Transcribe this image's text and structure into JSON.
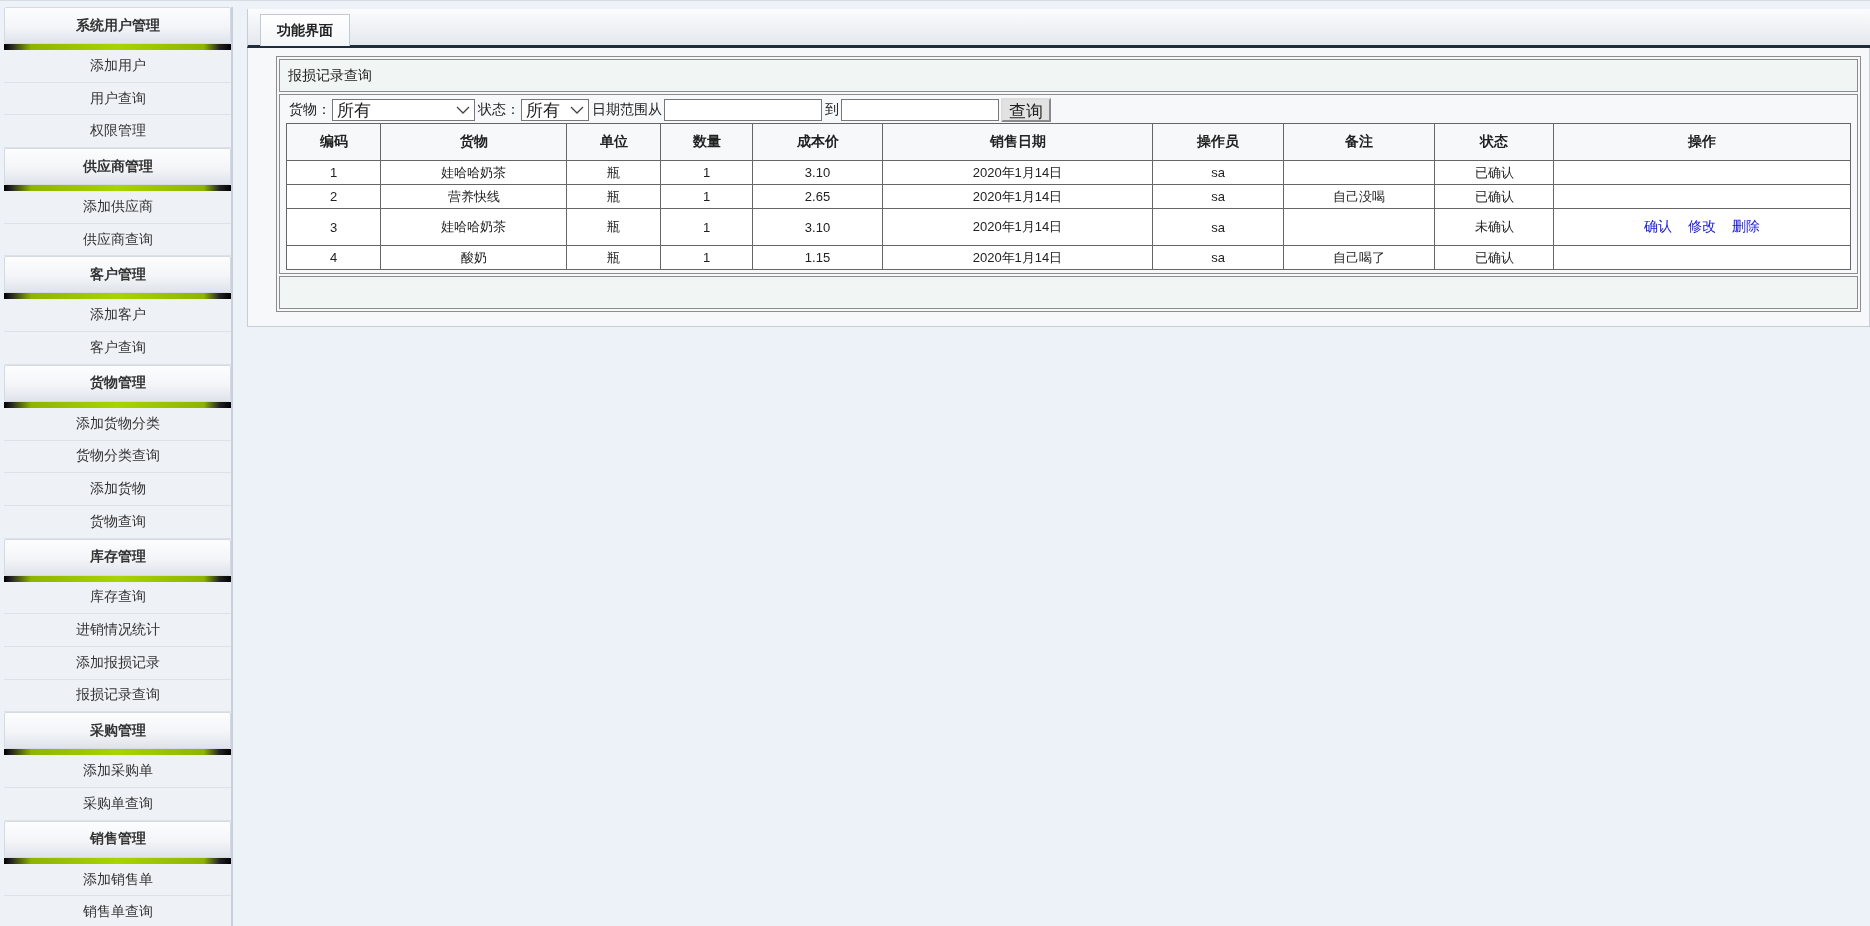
{
  "sidebar": {
    "sections": [
      {
        "title": "系统用户管理",
        "items": [
          {
            "label": "添加用户",
            "selected": false
          },
          {
            "label": "用户查询",
            "selected": false
          },
          {
            "label": "权限管理",
            "selected": false
          }
        ]
      },
      {
        "title": "供应商管理",
        "items": [
          {
            "label": "添加供应商",
            "selected": false
          },
          {
            "label": "供应商查询",
            "selected": false
          }
        ]
      },
      {
        "title": "客户管理",
        "items": [
          {
            "label": "添加客户",
            "selected": false
          },
          {
            "label": "客户查询",
            "selected": false
          }
        ]
      },
      {
        "title": "货物管理",
        "items": [
          {
            "label": "添加货物分类",
            "selected": false
          },
          {
            "label": "货物分类查询",
            "selected": false
          },
          {
            "label": "添加货物",
            "selected": false
          },
          {
            "label": "货物查询",
            "selected": false
          }
        ]
      },
      {
        "title": "库存管理",
        "items": [
          {
            "label": "库存查询",
            "selected": false
          },
          {
            "label": "进销情况统计",
            "selected": false
          },
          {
            "label": "添加报损记录",
            "selected": false
          },
          {
            "label": "报损记录查询",
            "selected": false
          }
        ]
      },
      {
        "title": "采购管理",
        "items": [
          {
            "label": "添加采购单",
            "selected": false
          },
          {
            "label": "采购单查询",
            "selected": false
          }
        ]
      },
      {
        "title": "销售管理",
        "items": [
          {
            "label": "添加销售单",
            "selected": false
          },
          {
            "label": "销售单查询",
            "selected": false
          }
        ]
      }
    ]
  },
  "tabs": [
    {
      "label": "功能界面",
      "selected": true
    }
  ],
  "panel": {
    "title": "报损记录查询",
    "filters": [
      {
        "kind": "select",
        "label": "货物：",
        "value": "所有"
      },
      {
        "kind": "select",
        "label": "状态：",
        "value": "所有"
      },
      {
        "kind": "text",
        "label": "日期范围从"
      },
      {
        "kind": "text",
        "label": "到"
      }
    ],
    "search_button": "查询",
    "table": {
      "columns": [
        "编码",
        "货物",
        "单位",
        "数量",
        "成本价",
        "销售日期",
        "操作员",
        "备注",
        "状态",
        "操作"
      ],
      "rows": [
        {
          "cells": [
            "1",
            "娃哈哈奶茶",
            "瓶",
            "1",
            "3.10",
            "2020年1月14日",
            "sa",
            "",
            "已确认"
          ]
        },
        {
          "cells": [
            "2",
            "营养快线",
            "瓶",
            "1",
            "2.65",
            "2020年1月14日",
            "sa",
            "自己没喝",
            "已确认"
          ]
        },
        {
          "cells": [
            "3",
            "娃哈哈奶茶",
            "瓶",
            "1",
            "3.10",
            "2020年1月14日",
            "sa",
            "",
            "未确认"
          ],
          "actions": [
            "确认",
            "修改",
            "删除"
          ]
        },
        {
          "cells": [
            "4",
            "酸奶",
            "瓶",
            "1",
            "1.15",
            "2020年1月14日",
            "sa",
            "自己喝了",
            "已确认"
          ]
        }
      ]
    }
  }
}
